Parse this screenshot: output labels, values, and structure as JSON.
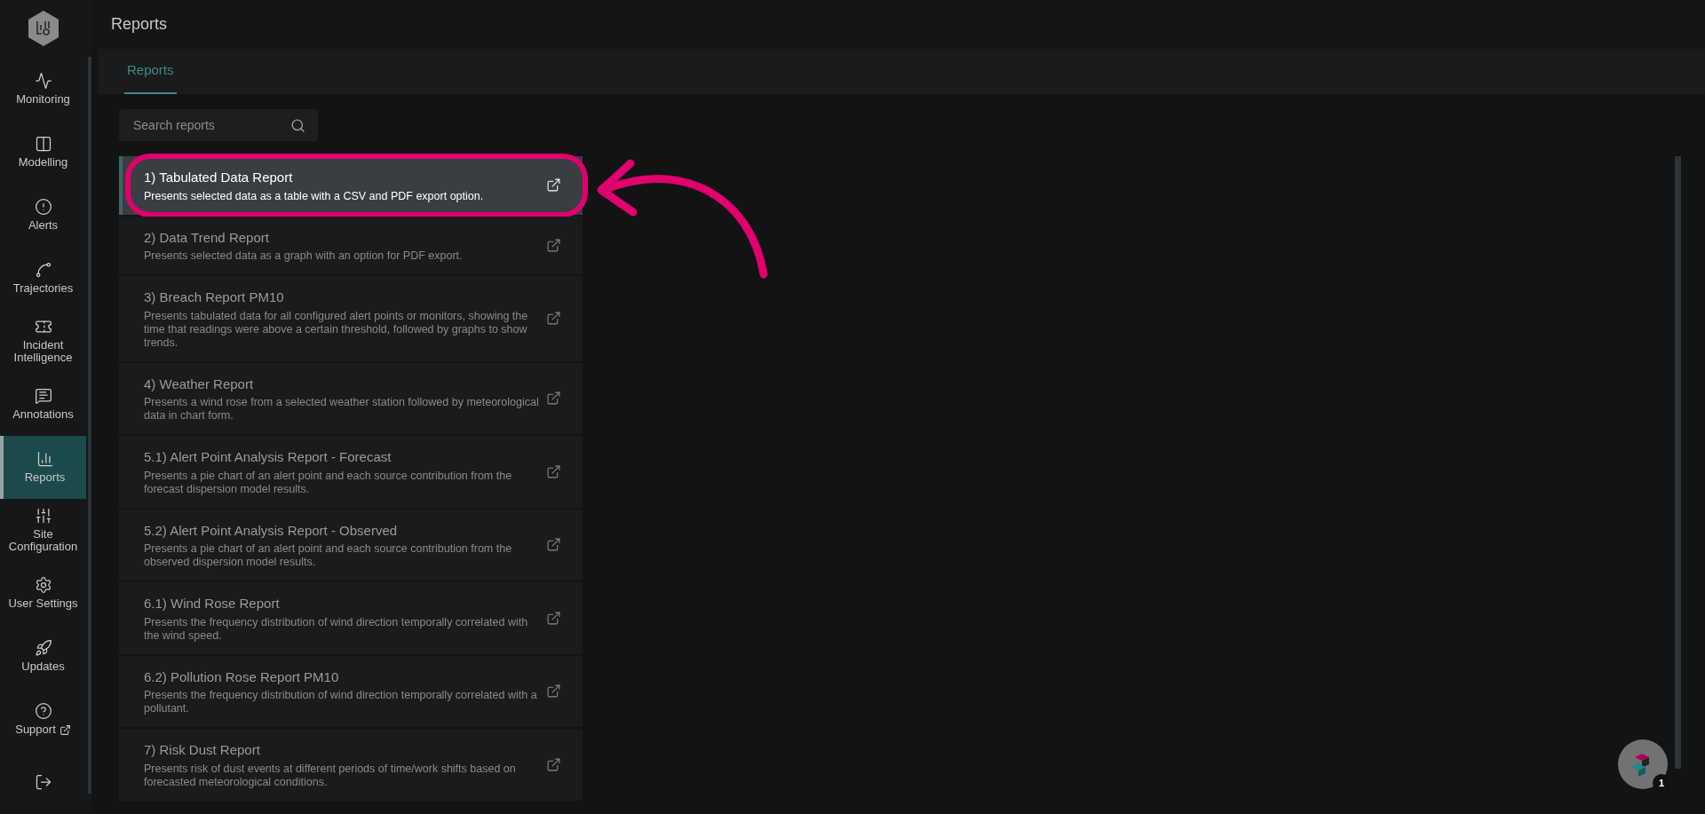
{
  "header": {
    "title": "Reports"
  },
  "tabs": [
    {
      "label": "Reports",
      "selected": true
    }
  ],
  "sidebar": {
    "items": [
      {
        "label": "Monitoring",
        "selected": false,
        "external": false
      },
      {
        "label": "Modelling",
        "selected": false,
        "external": false
      },
      {
        "label": "Alerts",
        "selected": false,
        "external": false
      },
      {
        "label": "Trajectories",
        "selected": false,
        "external": false
      },
      {
        "label": "Incident Intelligence",
        "selected": false,
        "external": false
      },
      {
        "label": "Annotations",
        "selected": false,
        "external": false
      },
      {
        "label": "Reports",
        "selected": true,
        "external": false
      },
      {
        "label": "Site Configuration",
        "selected": false,
        "external": false
      },
      {
        "label": "User Settings",
        "selected": false,
        "external": false
      },
      {
        "label": "Updates",
        "selected": false,
        "external": false
      },
      {
        "label": "Support",
        "selected": false,
        "external": true
      },
      {
        "selected": false,
        "external": false
      }
    ]
  },
  "search": {
    "placeholder": "Search reports"
  },
  "reports": [
    {
      "title": "1) Tabulated Data Report",
      "description": "Presents selected data as a table with a CSV and PDF export option.",
      "selected": true
    },
    {
      "title": "2) Data Trend Report",
      "description": "Presents selected data as a graph with an option for PDF export.",
      "selected": false
    },
    {
      "title": "3) Breach Report PM10",
      "description": "Presents tabulated data for all configured alert points or monitors, showing the time that readings were above a certain threshold, followed by graphs to show trends.",
      "selected": false
    },
    {
      "title": "4) Weather Report",
      "description": "Presents a wind rose from a selected weather station followed by meteorological data in chart form.",
      "selected": false
    },
    {
      "title": "5.1) Alert Point Analysis Report - Forecast",
      "description": "Presents a pie chart of an alert point and each source contribution from the forecast dispersion model results.",
      "selected": false
    },
    {
      "title": "5.2) Alert Point Analysis Report - Observed",
      "description": "Presents a pie chart of an alert point and each source contribution from the observed dispersion model results.",
      "selected": false
    },
    {
      "title": "6.1) Wind Rose Report",
      "description": "Presents the frequency distribution of wind direction temporally correlated with the wind speed.",
      "selected": false
    },
    {
      "title": "6.2) Pollution Rose Report PM10",
      "description": "Presents the frequency distribution of wind direction temporally correlated with a pollutant.",
      "selected": false
    },
    {
      "title": "7) Risk Dust Report",
      "description": "Presents risk of dust events at different periods of time/work shifts based on forecasted meteorological conditions.",
      "selected": false
    }
  ],
  "help_button": {
    "badge": "1"
  }
}
